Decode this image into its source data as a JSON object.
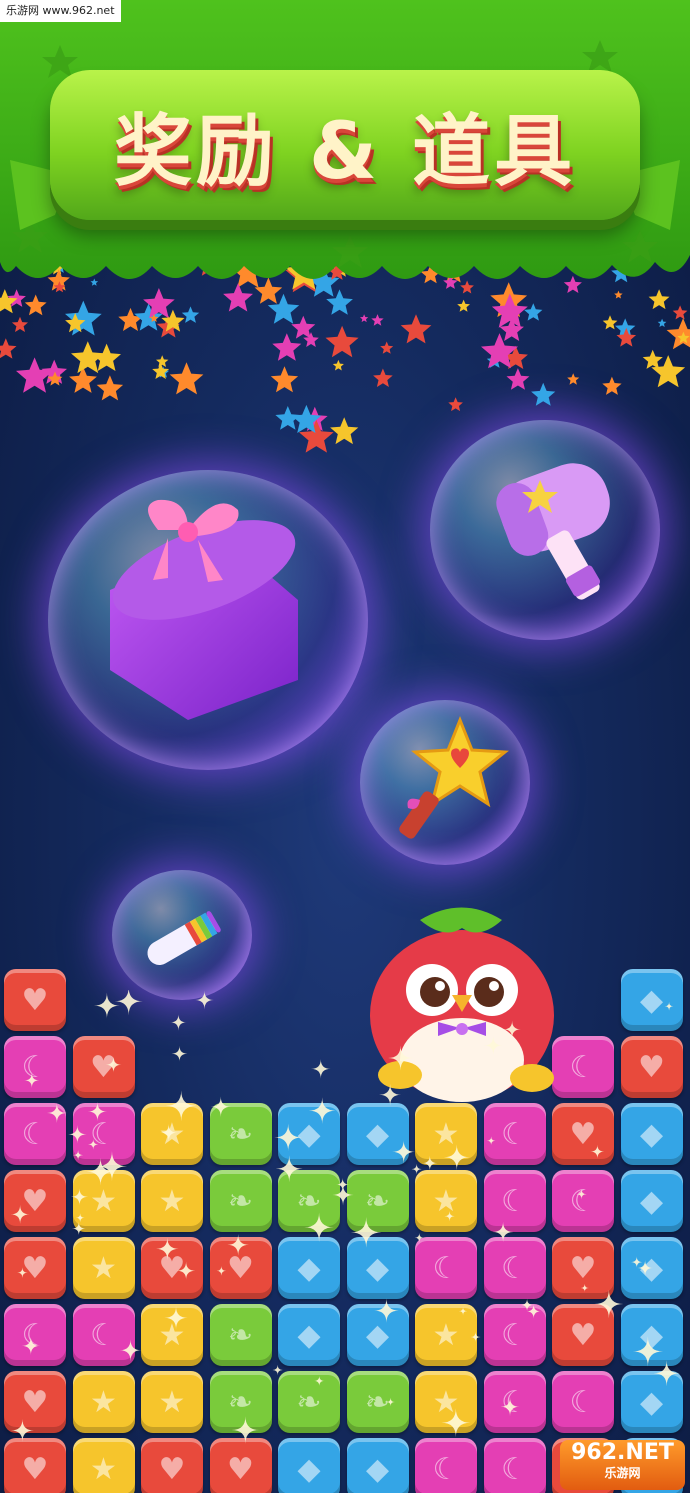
{
  "watermark_top": "乐游网 www.962.net",
  "title": "奖励 & 道具",
  "watermark_bottom": {
    "brand": "962.NET",
    "sub": "乐游网"
  },
  "items": [
    {
      "name": "gift-box",
      "icon": "gift-icon"
    },
    {
      "name": "hammer",
      "icon": "hammer-icon"
    },
    {
      "name": "magic-wand",
      "icon": "star-wand-icon"
    },
    {
      "name": "rainbow-rocket",
      "icon": "rainbow-rocket-icon"
    }
  ],
  "character": {
    "name": "red-bird",
    "icon": "bird-mascot-icon"
  },
  "colors": {
    "red": "#e84a3c",
    "pink": "#e43fb4",
    "yellow": "#f6c52c",
    "green": "#7acb3b",
    "blue": "#34a5e6",
    "banner": "#6ccf22"
  },
  "tile_rows": [
    [
      "red",
      "",
      "",
      "",
      "",
      "",
      "",
      "",
      "",
      "blue"
    ],
    [
      "pink",
      "red",
      "",
      "",
      "",
      "",
      "",
      "",
      "pink",
      "red"
    ],
    [
      "pink",
      "pink",
      "yellow",
      "green",
      "blue",
      "blue",
      "yellow",
      "pink",
      "red",
      "blue"
    ],
    [
      "red",
      "yellow",
      "yellow",
      "green",
      "green",
      "green",
      "yellow",
      "pink",
      "pink",
      "blue"
    ],
    [
      "red",
      "yellow",
      "red",
      "red",
      "blue",
      "blue",
      "pink",
      "pink",
      "red",
      "blue"
    ],
    [
      "pink",
      "pink",
      "yellow",
      "green",
      "blue",
      "blue",
      "yellow",
      "pink",
      "red",
      "blue"
    ],
    [
      "red",
      "yellow",
      "yellow",
      "green",
      "green",
      "green",
      "yellow",
      "pink",
      "pink",
      "blue"
    ],
    [
      "red",
      "yellow",
      "red",
      "red",
      "blue",
      "blue",
      "pink",
      "pink",
      "red",
      "blue"
    ]
  ]
}
